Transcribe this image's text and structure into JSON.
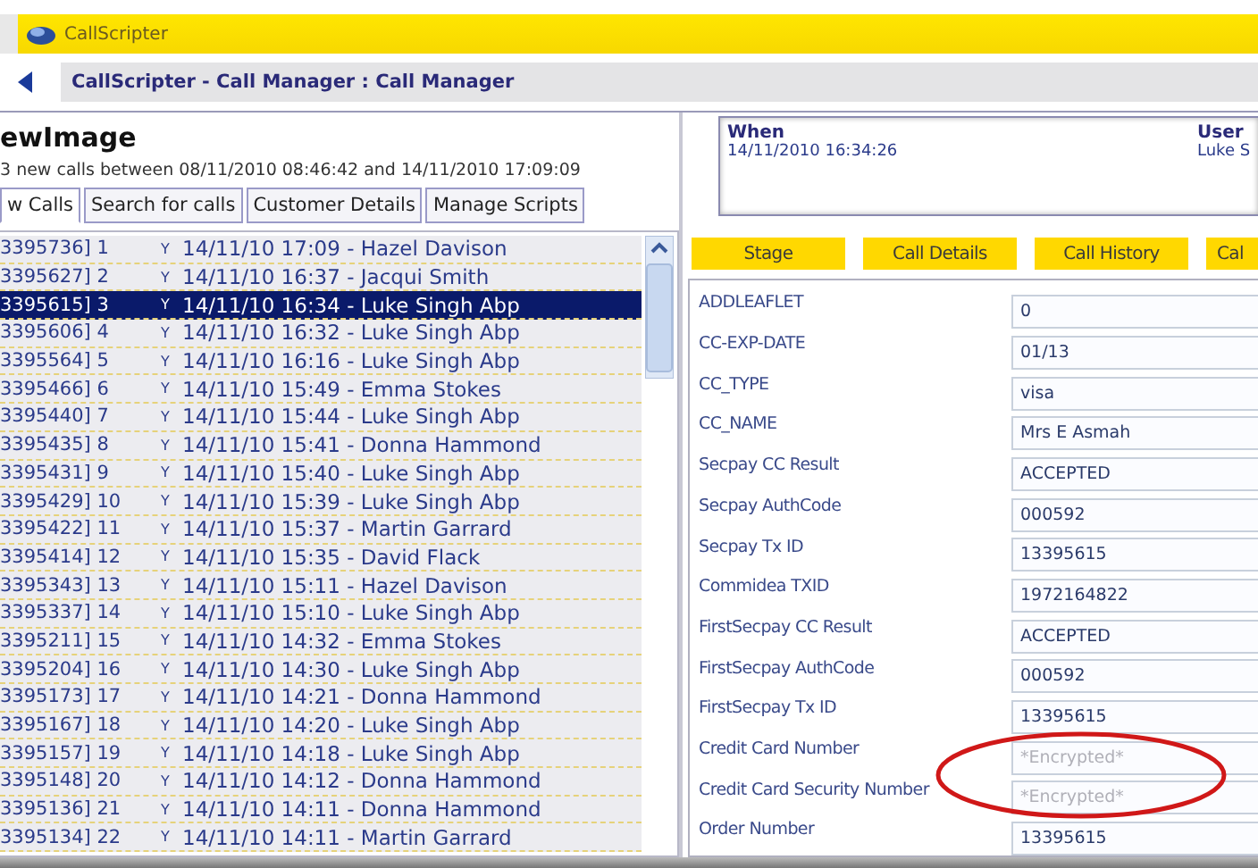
{
  "app": {
    "title": "CallScripter"
  },
  "header": {
    "title": "CallScripter - Call Manager : Call Manager"
  },
  "view": {
    "title": "ewImage",
    "summary": "3 new calls between 08/11/2010 08:46:42 and 14/11/2010 17:09:09"
  },
  "tabs": [
    {
      "label": "w Calls",
      "selected": true
    },
    {
      "label": "Search for calls",
      "selected": false
    },
    {
      "label": "Customer Details",
      "selected": false
    },
    {
      "label": "Manage Scripts",
      "selected": false
    }
  ],
  "calls": [
    {
      "id": "3395736] 1",
      "flag": "Y",
      "text": "14/11/10 17:09 - Hazel Davison",
      "selected": false
    },
    {
      "id": "3395627] 2",
      "flag": "Y",
      "text": "14/11/10 16:37 - Jacqui Smith",
      "selected": false
    },
    {
      "id": "3395615] 3",
      "flag": "Y",
      "text": "14/11/10 16:34 - Luke Singh Abp",
      "selected": true
    },
    {
      "id": "3395606] 4",
      "flag": "Y",
      "text": "14/11/10 16:32 - Luke Singh Abp",
      "selected": false
    },
    {
      "id": "3395564] 5",
      "flag": "Y",
      "text": "14/11/10 16:16 - Luke Singh Abp",
      "selected": false
    },
    {
      "id": "3395466] 6",
      "flag": "Y",
      "text": "14/11/10 15:49 - Emma Stokes",
      "selected": false
    },
    {
      "id": "3395440] 7",
      "flag": "Y",
      "text": "14/11/10 15:44 - Luke Singh Abp",
      "selected": false
    },
    {
      "id": "3395435] 8",
      "flag": "Y",
      "text": "14/11/10 15:41 - Donna Hammond",
      "selected": false
    },
    {
      "id": "3395431] 9",
      "flag": "Y",
      "text": "14/11/10 15:40 - Luke Singh Abp",
      "selected": false
    },
    {
      "id": "3395429] 10",
      "flag": "Y",
      "text": "14/11/10 15:39 - Luke Singh Abp",
      "selected": false
    },
    {
      "id": "3395422] 11",
      "flag": "Y",
      "text": "14/11/10 15:37 - Martin Garrard",
      "selected": false
    },
    {
      "id": "3395414] 12",
      "flag": "Y",
      "text": "14/11/10 15:35 - David Flack",
      "selected": false
    },
    {
      "id": "3395343] 13",
      "flag": "Y",
      "text": "14/11/10 15:11 - Hazel Davison",
      "selected": false
    },
    {
      "id": "3395337] 14",
      "flag": "Y",
      "text": "14/11/10 15:10 - Luke Singh Abp",
      "selected": false
    },
    {
      "id": "3395211] 15",
      "flag": "Y",
      "text": "14/11/10 14:32 - Emma Stokes",
      "selected": false
    },
    {
      "id": "3395204] 16",
      "flag": "Y",
      "text": "14/11/10 14:30 - Luke Singh Abp",
      "selected": false
    },
    {
      "id": "3395173] 17",
      "flag": "Y",
      "text": "14/11/10 14:21 - Donna Hammond",
      "selected": false
    },
    {
      "id": "3395167] 18",
      "flag": "Y",
      "text": "14/11/10 14:20 - Luke Singh Abp",
      "selected": false
    },
    {
      "id": "3395157] 19",
      "flag": "Y",
      "text": "14/11/10 14:18 - Luke Singh Abp",
      "selected": false
    },
    {
      "id": "3395148] 20",
      "flag": "Y",
      "text": "14/11/10 14:12 - Donna Hammond",
      "selected": false
    },
    {
      "id": "3395136] 21",
      "flag": "Y",
      "text": "14/11/10 14:11 - Donna Hammond",
      "selected": false
    },
    {
      "id": "3395134] 22",
      "flag": "Y",
      "text": "14/11/10 14:11 - Martin Garrard",
      "selected": false
    }
  ],
  "detail": {
    "when_label": "When",
    "when": "14/11/2010 16:34:26",
    "user_label": "User",
    "user": "Luke S"
  },
  "buttons": [
    "Stage",
    "Call Details",
    "Call History",
    "Cal"
  ],
  "fields": [
    {
      "label": "ADDLEAFLET",
      "value": "0",
      "disabled": false
    },
    {
      "label": "CC-EXP-DATE",
      "value": "01/13",
      "disabled": false
    },
    {
      "label": "CC_TYPE",
      "value": "visa",
      "disabled": false
    },
    {
      "label": "CC_NAME",
      "value": "Mrs E Asmah",
      "disabled": false
    },
    {
      "label": "Secpay CC Result",
      "value": "ACCEPTED",
      "disabled": false
    },
    {
      "label": "Secpay AuthCode",
      "value": "000592",
      "disabled": false
    },
    {
      "label": "Secpay Tx ID",
      "value": "13395615",
      "disabled": false
    },
    {
      "label": "Commidea TXID",
      "value": "1972164822",
      "disabled": false
    },
    {
      "label": "FirstSecpay CC Result",
      "value": "ACCEPTED",
      "disabled": false
    },
    {
      "label": "FirstSecpay AuthCode",
      "value": "000592",
      "disabled": false
    },
    {
      "label": "FirstSecpay Tx ID",
      "value": "13395615",
      "disabled": false
    },
    {
      "label": "Credit Card Number",
      "value": "*Encrypted*",
      "disabled": true
    },
    {
      "label": "Credit Card Security Number",
      "value": "*Encrypted*",
      "disabled": true
    },
    {
      "label": "Order Number",
      "value": "13395615",
      "disabled": false
    }
  ]
}
